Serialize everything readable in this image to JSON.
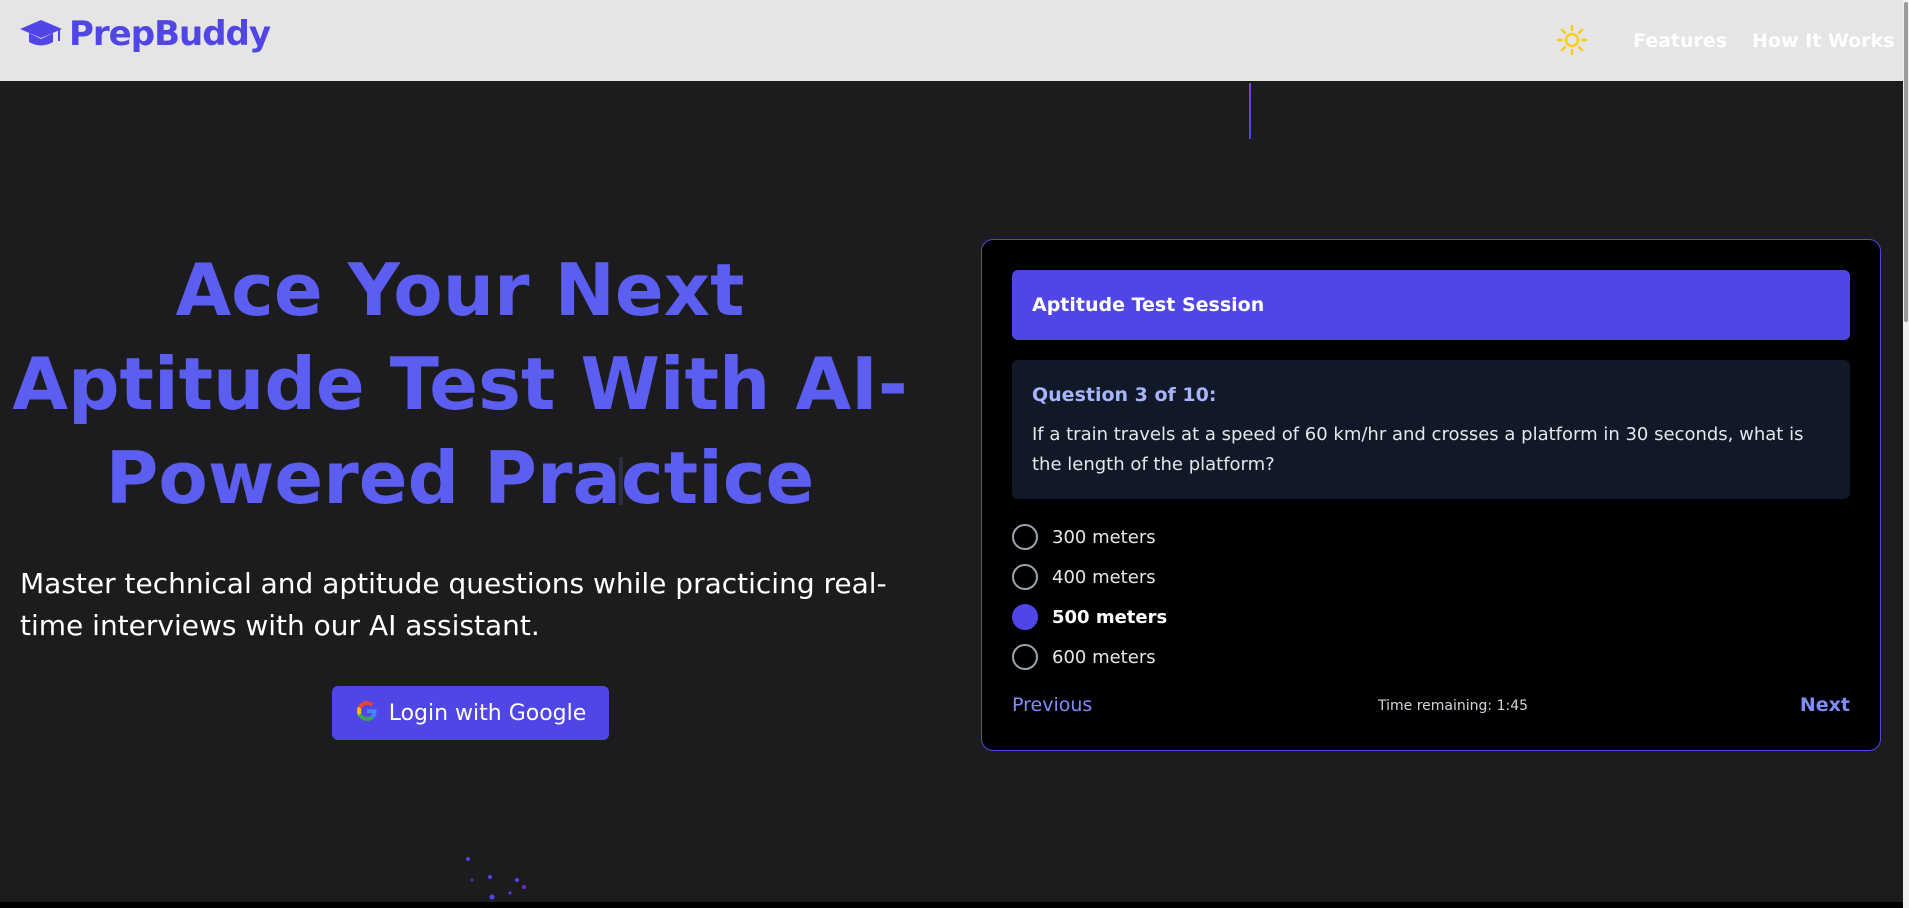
{
  "navbar": {
    "brand": "PrepBuddy",
    "logo_icon": "graduation-cap-icon",
    "theme_icon": "sun-icon",
    "links": [
      "Features",
      "How It Works"
    ]
  },
  "hero": {
    "title": "Ace Your Next Aptitude Test With AI-Powered Practice",
    "subtitle": "Master technical and aptitude questions while practicing real-time interviews with our AI assistant.",
    "login_label": "Login with Google",
    "login_icon": "google-icon"
  },
  "quiz": {
    "header": "Aptitude Test Session",
    "question_number": "Question 3 of 10:",
    "question_text": "If a train travels at a speed of 60 km/hr and crosses a platform in 30 seconds, what is the length of the platform?",
    "options": [
      {
        "label": "300 meters",
        "selected": false
      },
      {
        "label": "400 meters",
        "selected": false
      },
      {
        "label": "500 meters",
        "selected": true
      },
      {
        "label": "600 meters",
        "selected": false
      }
    ],
    "previous_label": "Previous",
    "timer": "Time remaining: 1:45",
    "next_label": "Next"
  },
  "colors": {
    "accent": "#4f46e5",
    "title": "#5b5ef0",
    "background": "#1c1c1f",
    "card": "#000000"
  }
}
